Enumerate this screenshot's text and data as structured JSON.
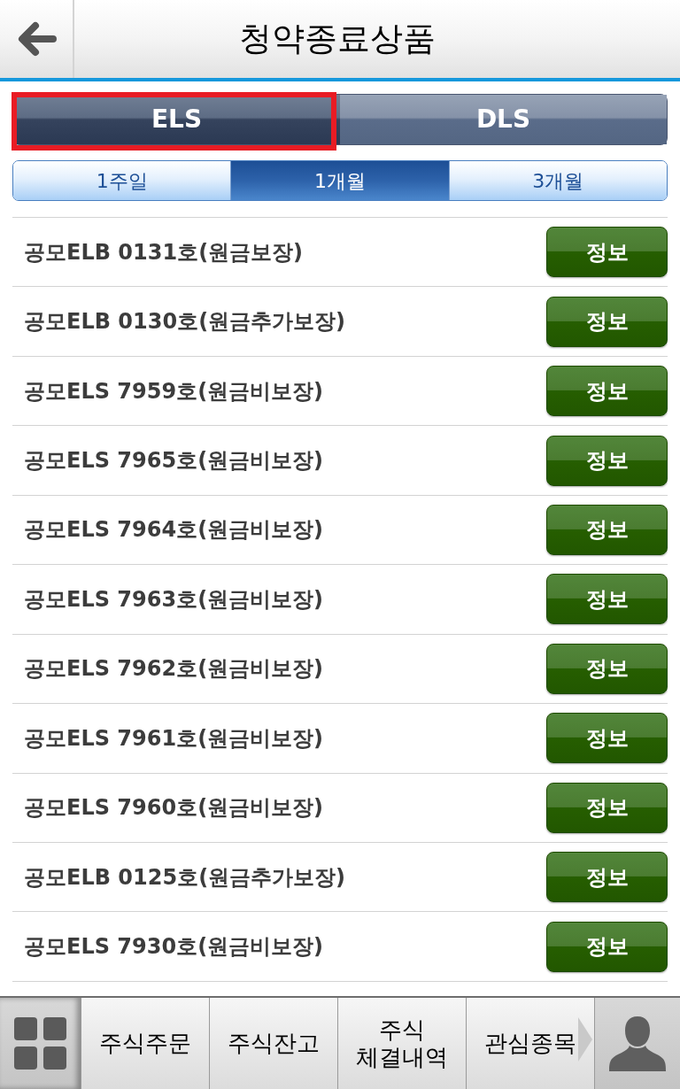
{
  "header": {
    "title": "청약종료상품"
  },
  "product_tabs": [
    {
      "label": "ELS",
      "selected": true,
      "highlighted": true
    },
    {
      "label": "DLS",
      "selected": false,
      "highlighted": false
    }
  ],
  "period_tabs": [
    {
      "label": "1주일",
      "selected": false
    },
    {
      "label": "1개월",
      "selected": true
    },
    {
      "label": "3개월",
      "selected": false
    }
  ],
  "products": [
    {
      "name": "공모ELB 0131호(원금보장)",
      "button": "정보"
    },
    {
      "name": "공모ELB 0130호(원금추가보장)",
      "button": "정보"
    },
    {
      "name": "공모ELS 7959호(원금비보장)",
      "button": "정보"
    },
    {
      "name": "공모ELS 7965호(원금비보장)",
      "button": "정보"
    },
    {
      "name": "공모ELS 7964호(원금비보장)",
      "button": "정보"
    },
    {
      "name": "공모ELS 7963호(원금비보장)",
      "button": "정보"
    },
    {
      "name": "공모ELS 7962호(원금비보장)",
      "button": "정보"
    },
    {
      "name": "공모ELS 7961호(원금비보장)",
      "button": "정보"
    },
    {
      "name": "공모ELS 7960호(원금비보장)",
      "button": "정보"
    },
    {
      "name": "공모ELB 0125호(원금추가보장)",
      "button": "정보"
    },
    {
      "name": "공모ELS 7930호(원금비보장)",
      "button": "정보"
    }
  ],
  "bottom_nav": {
    "items": [
      {
        "lines": [
          "주식주문"
        ],
        "more": false
      },
      {
        "lines": [
          "주식잔고"
        ],
        "more": false
      },
      {
        "lines": [
          "주식",
          "체결내역"
        ],
        "more": false
      },
      {
        "lines": [
          "관심종목"
        ],
        "more": true
      }
    ]
  }
}
